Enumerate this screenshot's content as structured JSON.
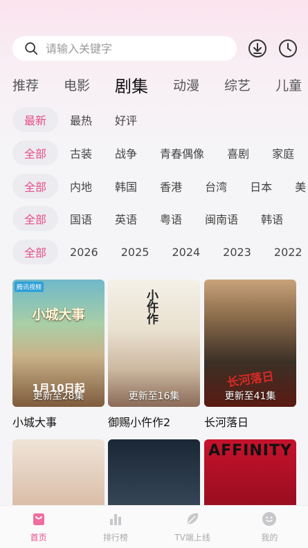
{
  "search": {
    "placeholder": "请输入关键字"
  },
  "top_icons": [
    "download-icon",
    "history-clock-icon"
  ],
  "main_tabs": [
    "推荐",
    "电影",
    "剧集",
    "动漫",
    "综艺",
    "儿童"
  ],
  "active_main_tab": "剧集",
  "filters": {
    "sort": [
      "最新",
      "最热",
      "好评"
    ],
    "genre": [
      "全部",
      "古装",
      "战争",
      "青春偶像",
      "喜剧",
      "家庭"
    ],
    "region": [
      "全部",
      "内地",
      "韩国",
      "香港",
      "台湾",
      "日本",
      "美"
    ],
    "language": [
      "全部",
      "国语",
      "英语",
      "粤语",
      "闽南语",
      "韩语"
    ],
    "year": [
      "全部",
      "2026",
      "2025",
      "2024",
      "2023",
      "2022"
    ]
  },
  "cards": [
    {
      "title": "小城大事",
      "caption": "更新至28集",
      "poster_text": "小城大事",
      "date_text": "1月10日起",
      "badge": "腾讯视频"
    },
    {
      "title": "御赐小仵作2",
      "caption": "更新至16集",
      "poster_text": "小仵作"
    },
    {
      "title": "长河落日",
      "caption": "更新至41集",
      "poster_text": "长河落日"
    },
    {
      "title": "",
      "caption": ""
    },
    {
      "title": "",
      "caption": ""
    },
    {
      "title": "",
      "caption": "",
      "poster_text": "AFFINITY"
    }
  ],
  "tabbar": [
    {
      "label": "首页",
      "icon": "home-icon",
      "active": true
    },
    {
      "label": "排行榜",
      "icon": "bar-chart-icon",
      "active": false
    },
    {
      "label": "TV端上线",
      "icon": "tv-leaf-icon",
      "active": false
    },
    {
      "label": "我的",
      "icon": "smile-face-icon",
      "active": false
    }
  ],
  "colors": {
    "accent": "#e64e8a",
    "chip_bg": "#ececf0"
  }
}
